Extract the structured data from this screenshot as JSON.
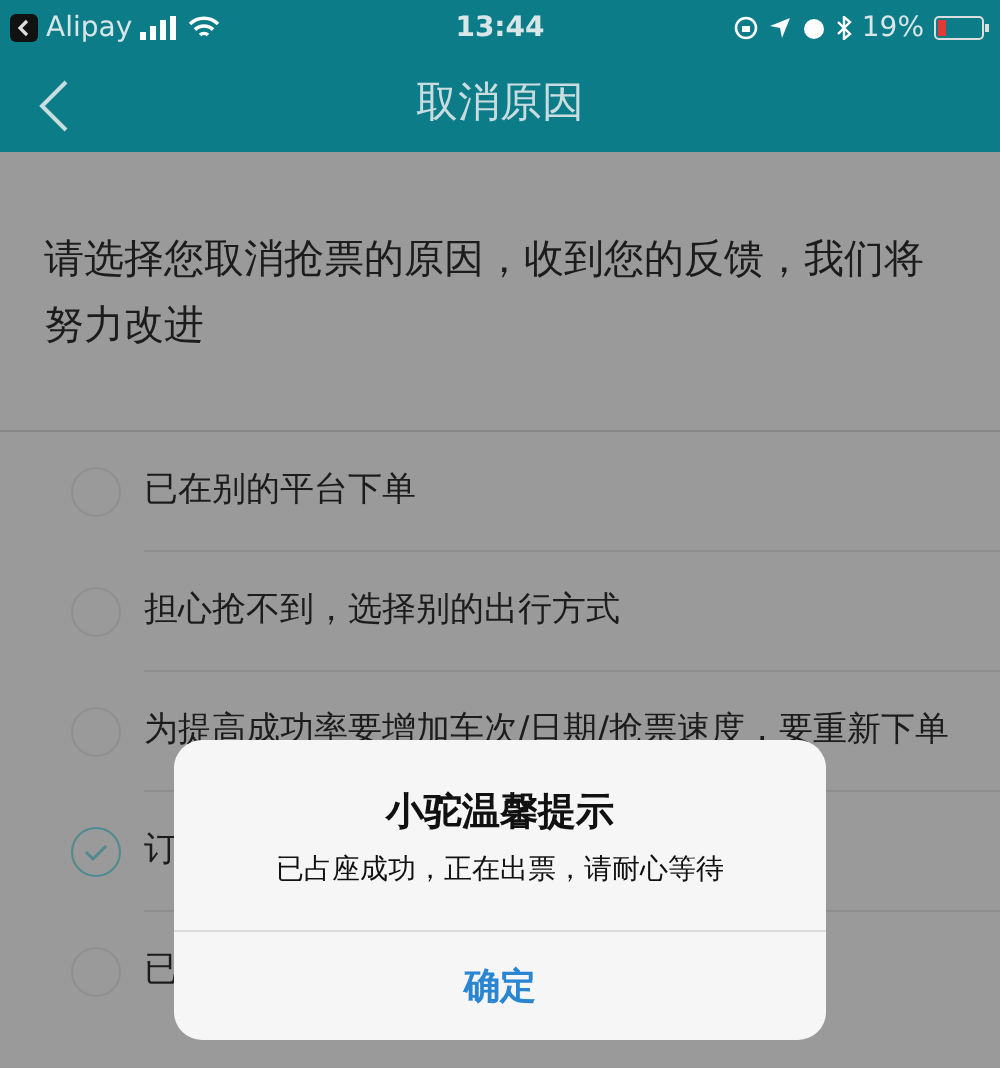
{
  "status_bar": {
    "app": "Alipay",
    "time": "13:44",
    "battery": "19%"
  },
  "nav": {
    "title": "取消原因"
  },
  "prompt": "请选择您取消抢票的原因，收到您的反馈，我们将努力改进",
  "reasons": [
    {
      "label": "已在别的平台下单",
      "selected": false
    },
    {
      "label": "担心抢不到，选择别的出行方式",
      "selected": false
    },
    {
      "label": "为提高成功率要增加车次/日期/抢票速度，要重新下单",
      "selected": false
    },
    {
      "label": "订",
      "selected": true
    },
    {
      "label": "已",
      "selected": false
    }
  ],
  "dialog": {
    "title": "小驼温馨提示",
    "message": "已占座成功，正在出票，请耐心等待",
    "button": "确定"
  }
}
